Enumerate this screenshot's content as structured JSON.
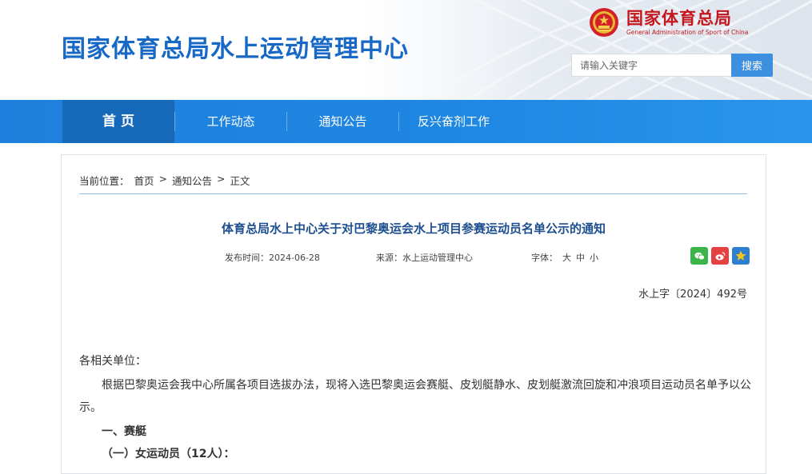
{
  "header": {
    "site_title": "国家体育总局水上运动管理中心",
    "brand_cn": "国家体育总局",
    "brand_en": "General Administration of Sport of China",
    "search_placeholder": "请输入关键字",
    "search_button": "搜索"
  },
  "nav": {
    "items": [
      {
        "label": "首 页",
        "active": true
      },
      {
        "label": "工作动态",
        "active": false
      },
      {
        "label": "通知公告",
        "active": false
      },
      {
        "label": "反兴奋剂工作",
        "active": false
      }
    ]
  },
  "breadcrumb": {
    "prefix": "当前位置：",
    "items": [
      "首页",
      "通知公告",
      "正文"
    ],
    "sep": ">"
  },
  "article": {
    "title": "体育总局水上中心关于对巴黎奥运会水上项目参赛运动员名单公示的通知",
    "date": "发布时间：2024-06-28",
    "source": "来源：水上运动管理中心",
    "font_label": "字体：",
    "font_sizes": [
      "大",
      "中",
      "小"
    ],
    "doc_number": "水上字〔2024〕492号",
    "salutation": "各相关单位：",
    "paragraph": "根据巴黎奥运会我中心所属各项目选拔办法，现将入选巴黎奥运会赛艇、皮划艇静水、皮划艇激流回旋和冲浪项目运动员名单予以公示。",
    "section1": "一、赛艇",
    "section2": "（一）女运动员（12人）："
  },
  "colors": {
    "title_blue": "#1769c5",
    "nav_blue": "#1f7fdc",
    "nav_active": "#1668b8",
    "brand_red": "#c4161c",
    "article_title": "#1d4f91"
  }
}
